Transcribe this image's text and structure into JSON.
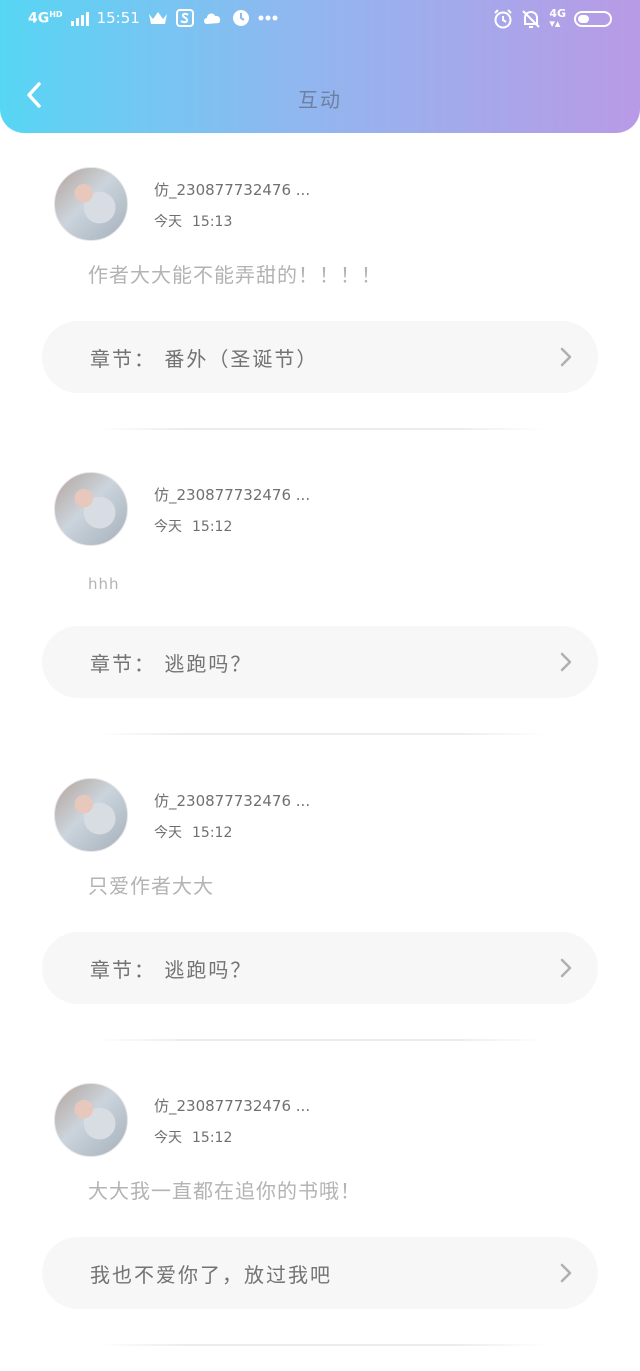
{
  "status_bar": {
    "network_left": "4G",
    "network_left_sup": "HD",
    "time": "15:51",
    "icons_left": [
      "crown-icon",
      "s-app-icon",
      "cloud-icon",
      "clock-icon",
      "more-dots-icon"
    ],
    "icons_right": [
      "alarm-icon",
      "bell-off-icon"
    ],
    "network_right": "4G",
    "battery_level": 0.35
  },
  "header": {
    "title": "互动",
    "back_icon": "chevron-left-icon",
    "colors": {
      "gradient_start": "#57d6f4",
      "gradient_end": "#b99ae6"
    }
  },
  "comments": [
    {
      "username": "仿_230877732476 ...",
      "date_label": "今天",
      "time": "15:13",
      "content": "作者大大能不能弄甜的！！！！",
      "chapter": "章节： 番外（圣诞节）"
    },
    {
      "username": "仿_230877732476 ...",
      "date_label": "今天",
      "time": "15:12",
      "content": "hhh",
      "chapter": "章节： 逃跑吗？"
    },
    {
      "username": "仿_230877732476 ...",
      "date_label": "今天",
      "time": "15:12",
      "content": "只爱作者大大",
      "chapter": "章节： 逃跑吗？"
    },
    {
      "username": "仿_230877732476 ...",
      "date_label": "今天",
      "time": "15:12",
      "content": "大大我一直都在追你的书哦！",
      "chapter": "我也不爱你了，放过我吧"
    }
  ]
}
